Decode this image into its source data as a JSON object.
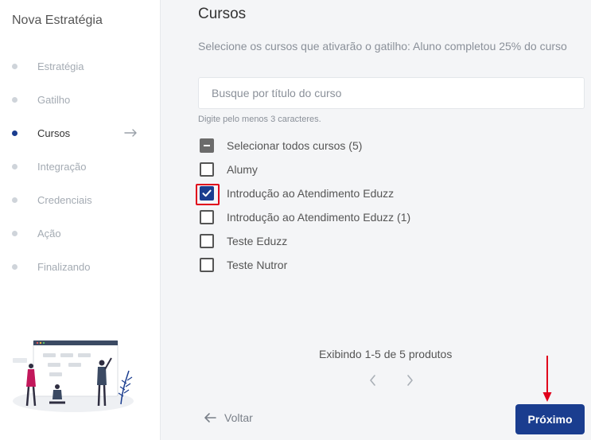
{
  "sidebar": {
    "title": "Nova Estratégia",
    "steps": [
      {
        "label": "Estratégia"
      },
      {
        "label": "Gatilho"
      },
      {
        "label": "Cursos"
      },
      {
        "label": "Integração"
      },
      {
        "label": "Credenciais"
      },
      {
        "label": "Ação"
      },
      {
        "label": "Finalizando"
      }
    ],
    "active_step": "Cursos"
  },
  "main": {
    "heading": "Cursos",
    "description": "Selecione os cursos que ativarão o gatilho: Aluno completou 25% do curso",
    "search_placeholder": "Busque por título do curso",
    "hint": "Digite pelo menos 3 caracteres.",
    "select_all_label": "Selecionar todos cursos (5)",
    "courses": [
      {
        "label": "Alumy",
        "checked": false
      },
      {
        "label": "Introdução ao Atendimento Eduzz",
        "checked": true
      },
      {
        "label": "Introdução ao Atendimento Eduzz (1)",
        "checked": false
      },
      {
        "label": "Teste Eduzz",
        "checked": false
      },
      {
        "label": "Teste Nutror",
        "checked": false
      }
    ],
    "pagination_text": "Exibindo 1-5 de 5 produtos",
    "back_label": "Voltar",
    "next_label": "Próximo"
  },
  "colors": {
    "accent": "#1a3d8f",
    "highlight": "#e0001b"
  }
}
